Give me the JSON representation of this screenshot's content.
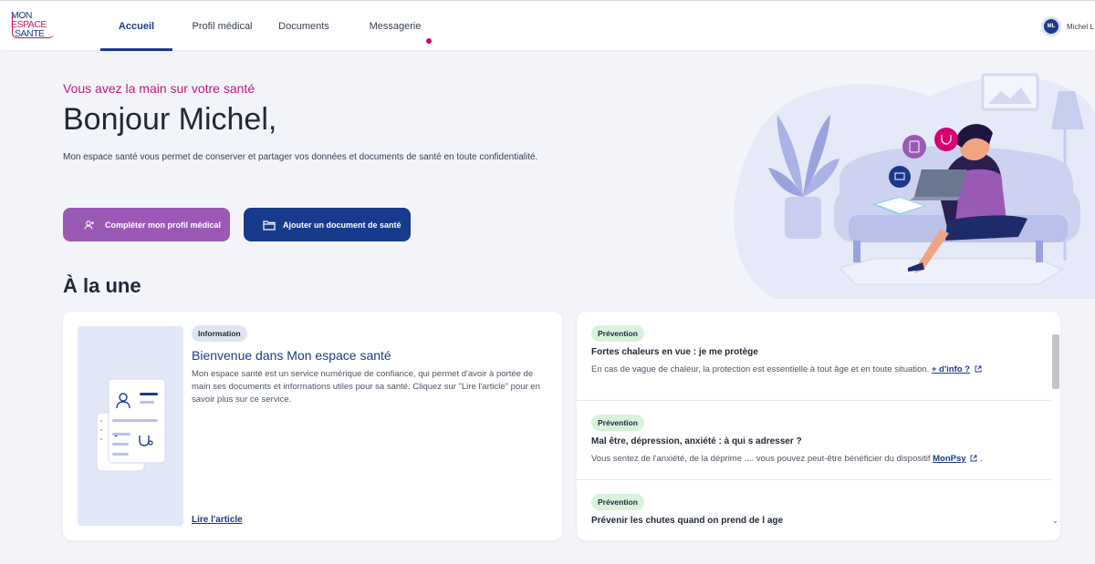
{
  "logo": {
    "line1": "MON",
    "line2": "ESPACE",
    "line3": "SANTE"
  },
  "nav": {
    "items": [
      {
        "label": "Accueil",
        "active": true
      },
      {
        "label": "Profil médical",
        "active": false
      },
      {
        "label": "Documents",
        "active": false
      },
      {
        "label": "Messagerie",
        "active": false,
        "has_notification": true
      }
    ]
  },
  "user": {
    "initials": "ML",
    "name": "Michel L"
  },
  "hero": {
    "tagline": "Vous avez la main sur votre santé",
    "greeting": "Bonjour Michel,",
    "intro": "Mon espace santé vous permet de conserver et partager vos données et documents de santé en toute confidentialité.",
    "btn_profile": "Compléter mon profil médical",
    "btn_document": "Ajouter un document de santé"
  },
  "section": {
    "title": "À la une"
  },
  "article": {
    "badge": "Information",
    "title": "Bienvenue dans Mon espace santé",
    "text": "Mon espace santé est un service numérique de confiance, qui permet d'avoir à portée de main ses documents et informations utiles pour sa santé. Cliquez sur \"Lire l'article\" pour en savoir plus sur ce service.",
    "link": "Lire l'article"
  },
  "news": [
    {
      "badge": "Prévention",
      "title": "Fortes chaleurs en vue : je me protège",
      "text": "En cas de vague de chaleur, la protection est essentielle à tout âge et en toute situation.",
      "link": "+ d'info ?",
      "after": ""
    },
    {
      "badge": "Prévention",
      "title": "Mal être, dépression, anxiété : à qui s adresser ?",
      "text": "Vous sentez de l'anxiété, de la déprime .... vous pouvez peut-être bénéficier du dispositif",
      "link": "MonPsy",
      "after": "."
    },
    {
      "badge": "Prévention",
      "title": "Prévenir les chutes quand on prend de l age",
      "text": "",
      "link": "",
      "after": ""
    }
  ],
  "colors": {
    "navy": "#1e3a8a",
    "purple": "#9b59b6",
    "pink": "#c2187a",
    "badge_green": "#d9f2dc",
    "badge_blue": "#dfe5f1"
  },
  "icons": {
    "btn_profile": "add-user-icon",
    "btn_document": "folder-icon",
    "external": "external-link-icon"
  }
}
